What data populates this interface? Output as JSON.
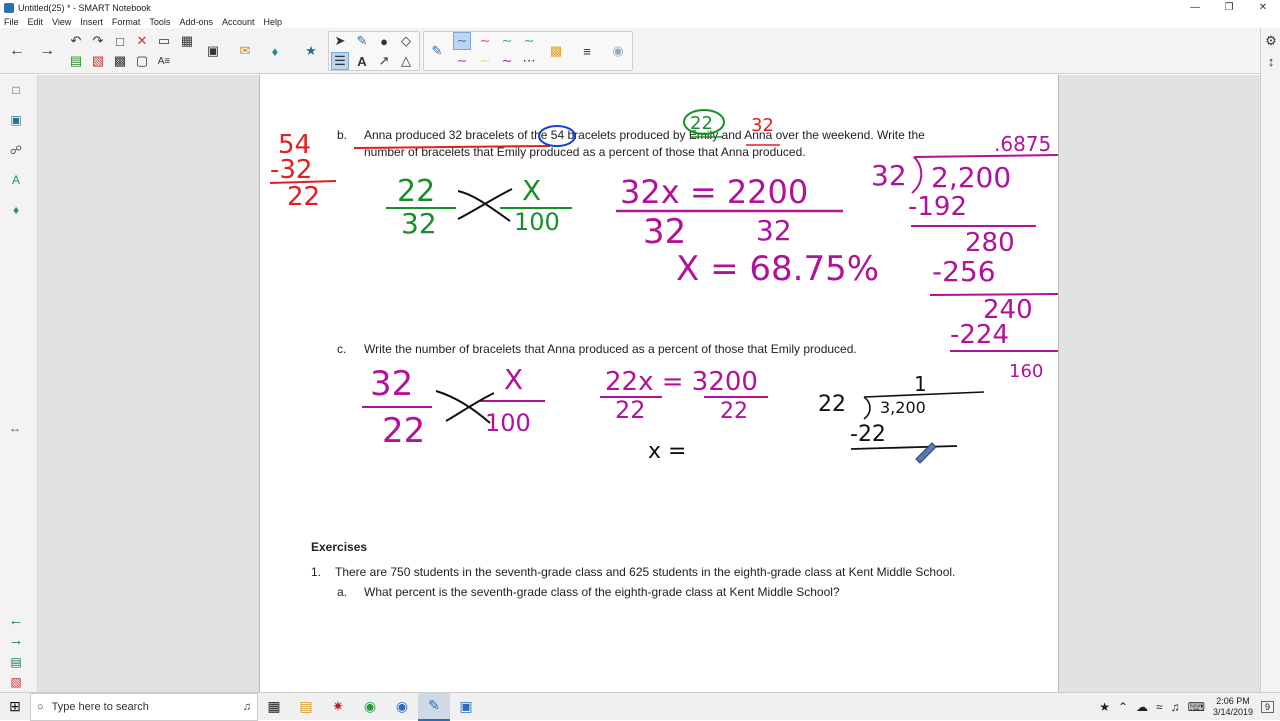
{
  "window": {
    "title": "Untitled(25) * - SMART Notebook",
    "controls": [
      "—",
      "❐",
      "✕"
    ]
  },
  "menu": [
    "File",
    "Edit",
    "View",
    "Insert",
    "Format",
    "Tools",
    "Add-ons",
    "Account",
    "Help"
  ],
  "toolbar": {
    "icons": [
      "back-icon",
      "forward-icon",
      "undo-icon",
      "redo-icon",
      "insert-page-icon",
      "delete-icon",
      "screen-shade-icon",
      "table-icon",
      "pointer-icon",
      "pen-icon",
      "eraser-icon",
      "line-icon",
      "text-icon"
    ]
  },
  "document": {
    "problem_b": {
      "label": "b.",
      "line1": "Anna produced 32 bracelets of the 54 bracelets produced by Emily and Anna over the weekend.  Write the",
      "line2": "number of bracelets that Emily produced as a percent of those that Anna produced."
    },
    "problem_c": {
      "label": "c.",
      "line1": "Write the number of bracelets that Anna produced as a percent of those that Emily produced."
    },
    "exercises": {
      "heading": "Exercises",
      "item1_num": "1.",
      "item1_text": "There are 750 students in the seventh-grade class and 625 students in the eighth-grade class at Kent Middle School.",
      "item1a_label": "a.",
      "item1a_text": "What percent is the seventh-grade class of the eighth-grade class at Kent Middle School?"
    },
    "ink": {
      "red_sub": [
        "54",
        "-32",
        "22"
      ],
      "circled_numbers": [
        "22",
        "32"
      ],
      "b_ratio": [
        "22",
        "32",
        "X",
        "100"
      ],
      "b_equation": [
        "32x = 2200",
        "32",
        "32"
      ],
      "b_result": "X = 68.75%",
      "b_longdiv": [
        ".6875",
        "32",
        "2,200",
        "-192",
        "280",
        "-256",
        "240",
        "-224",
        "160"
      ],
      "c_ratio": [
        "32",
        "22",
        "X",
        "100"
      ],
      "c_equation": [
        "22x = 3200",
        "22",
        "22"
      ],
      "c_partial": "x =",
      "c_longdiv": [
        "1",
        "22",
        "3,200",
        "-22"
      ]
    },
    "colors": {
      "red": "#e02020",
      "green": "#18902a",
      "purple": "#b0139a",
      "blue": "#1a3fd0",
      "black": "#111111"
    }
  },
  "taskbar": {
    "search_placeholder": "Type here to search",
    "time": "2:06 PM",
    "date": "3/14/2019",
    "notification_count": "9"
  }
}
